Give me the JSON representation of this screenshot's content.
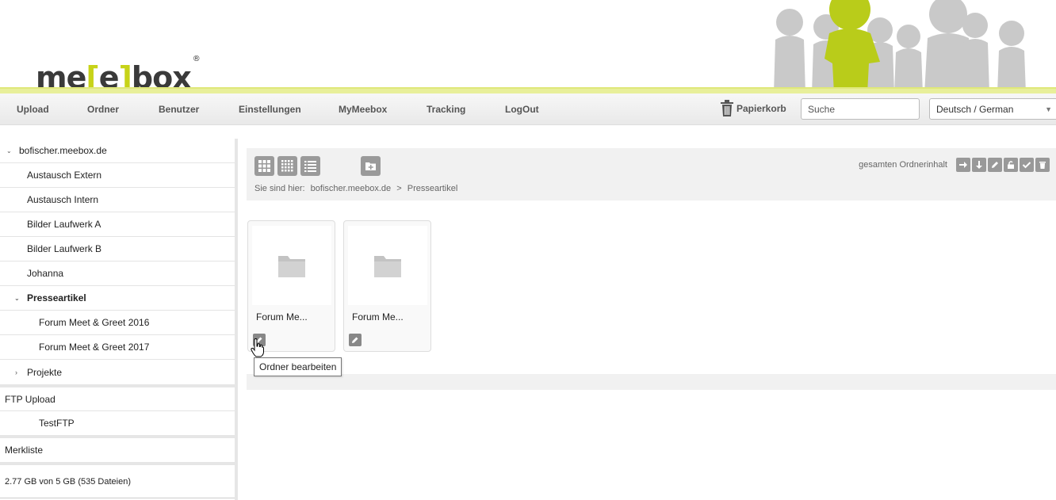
{
  "brand": {
    "logo_pre": "me",
    "logo_bracket_open": "[",
    "logo_mid": "e",
    "logo_bracket_close": "]",
    "logo_post": "box",
    "registered": "®",
    "accent": "#c7d319"
  },
  "nav": {
    "items": [
      "Upload",
      "Ordner",
      "Benutzer",
      "Einstellungen",
      "MyMeebox",
      "Tracking",
      "LogOut"
    ],
    "trash_label": "Papierkorb",
    "search_placeholder": "Suche",
    "language": "Deutsch / German"
  },
  "sidebar": {
    "root": "bofischer.meebox.de",
    "items": [
      "Austausch Extern",
      "Austausch Intern",
      "Bilder Laufwerk A",
      "Bilder Laufwerk B",
      "Johanna"
    ],
    "expanded": "Presseartikel",
    "children": [
      "Forum Meet & Greet 2016",
      "Forum Meet & Greet 2017"
    ],
    "collapsed": "Projekte",
    "ftp_title": "FTP Upload",
    "ftp_items": [
      "TestFTP"
    ],
    "watchlist": "Merkliste",
    "quota": "2.77 GB von 5 GB (535 Dateien)"
  },
  "toolbar": {
    "breadcrumb_prefix": "Sie sind hier:",
    "breadcrumb": [
      "bofischer.meebox.de",
      ">",
      "Presseartikel"
    ],
    "all_content_label": "gesamten Ordnerinhalt"
  },
  "folders": [
    {
      "name": "Forum Me..."
    },
    {
      "name": "Forum Me..."
    }
  ],
  "tooltip": "Ordner bearbeiten"
}
